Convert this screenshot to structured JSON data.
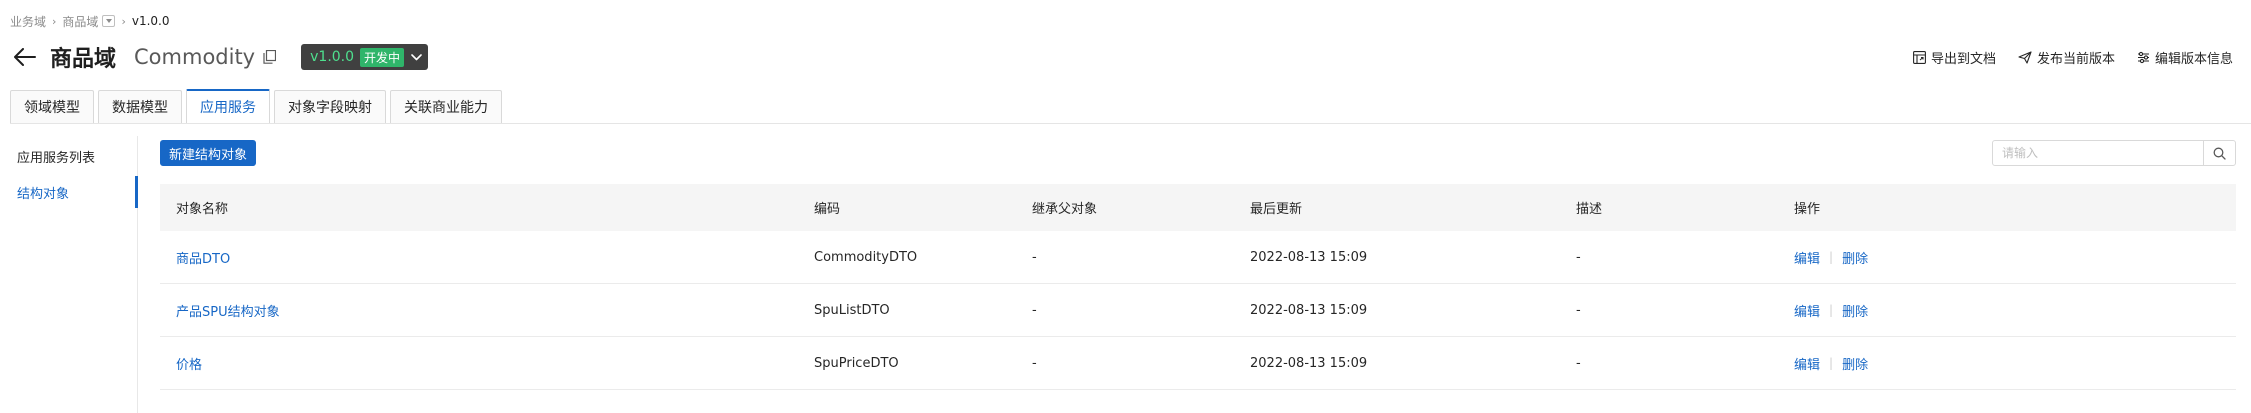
{
  "breadcrumb": {
    "items": [
      "业务域",
      "商品域",
      "v1.0.0"
    ]
  },
  "header": {
    "title": "商品域",
    "code": "Commodity",
    "version": "v1.0.0",
    "status": "开发中",
    "icons": {
      "back": "arrow-left-icon",
      "copy": "copy-icon",
      "dropdown": "chevron-down-icon"
    }
  },
  "actions": [
    {
      "label": "导出到文档",
      "icon": "export-doc-icon"
    },
    {
      "label": "发布当前版本",
      "icon": "send-icon"
    },
    {
      "label": "编辑版本信息",
      "icon": "settings-icon"
    }
  ],
  "tabs": [
    {
      "label": "领域模型",
      "active": false
    },
    {
      "label": "数据模型",
      "active": false
    },
    {
      "label": "应用服务",
      "active": true
    },
    {
      "label": "对象字段映射",
      "active": false
    },
    {
      "label": "关联商业能力",
      "active": false
    }
  ],
  "sidebar": {
    "items": [
      {
        "label": "应用服务列表",
        "active": false
      },
      {
        "label": "结构对象",
        "active": true
      }
    ]
  },
  "toolbar": {
    "new_label": "新建结构对象",
    "search_placeholder": "请输入"
  },
  "table": {
    "columns": [
      "对象名称",
      "编码",
      "继承父对象",
      "最后更新",
      "描述",
      "操作"
    ],
    "rows": [
      {
        "name": "商品DTO",
        "code": "CommodityDTO",
        "parent": "-",
        "updated": "2022-08-13 15:09",
        "desc": "-",
        "edit": "编辑",
        "delete": "删除"
      },
      {
        "name": "产品SPU结构对象",
        "code": "SpuListDTO",
        "parent": "-",
        "updated": "2022-08-13 15:09",
        "desc": "-",
        "edit": "编辑",
        "delete": "删除"
      },
      {
        "name": "价格",
        "code": "SpuPriceDTO",
        "parent": "-",
        "updated": "2022-08-13 15:09",
        "desc": "-",
        "edit": "编辑",
        "delete": "删除"
      }
    ]
  },
  "colors": {
    "accent": "#1767c6",
    "version_bg": "#404040",
    "version_text": "#4ee08e",
    "status_bg": "#2fb56a"
  }
}
